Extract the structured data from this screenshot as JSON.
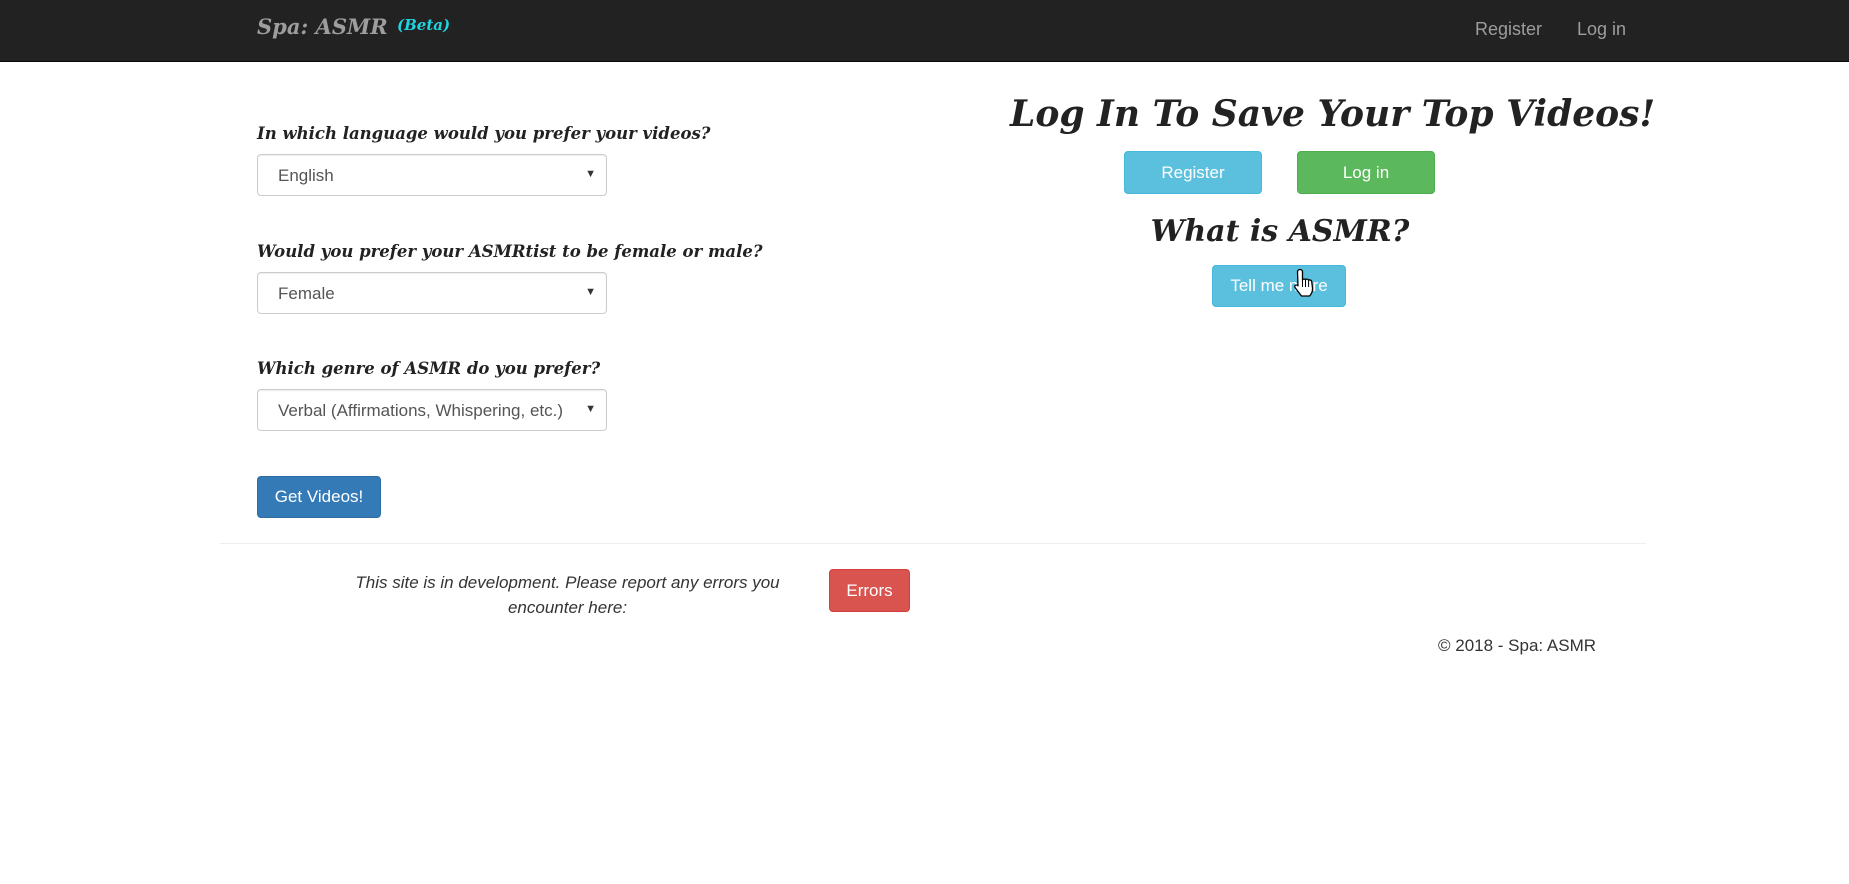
{
  "navbar": {
    "brand": "Spa: ASMR",
    "brand_badge": "(Beta)",
    "links": [
      "Register",
      "Log in"
    ]
  },
  "form": {
    "language": {
      "label": "In which language would you prefer your videos?",
      "value": "English"
    },
    "gender": {
      "label": "Would you prefer your ASMRtist to be female or male?",
      "value": "Female"
    },
    "genre": {
      "label": "Which genre of ASMR do you prefer?",
      "value": "Verbal (Affirmations, Whispering, etc.)"
    },
    "submit_label": "Get Videos!"
  },
  "login_panel": {
    "title": "Log In To Save Your Top Videos!",
    "register_label": "Register",
    "login_label": "Log in"
  },
  "about": {
    "title": "What is ASMR?",
    "button_label": "Tell me more"
  },
  "footer": {
    "note": "This site is in development. Please report any errors you encounter here:",
    "errors_label": "Errors",
    "copyright": "© 2018 - Spa: ASMR"
  },
  "colors": {
    "navbar_bg": "#222222",
    "beta_accent": "#1fd4e0",
    "primary": "#337ab7",
    "info": "#5bc0de",
    "success": "#5cb85c",
    "danger": "#d9534f"
  },
  "icons": {
    "cursor": "hand-pointer-icon",
    "select_caret": "caret-down-icon"
  }
}
